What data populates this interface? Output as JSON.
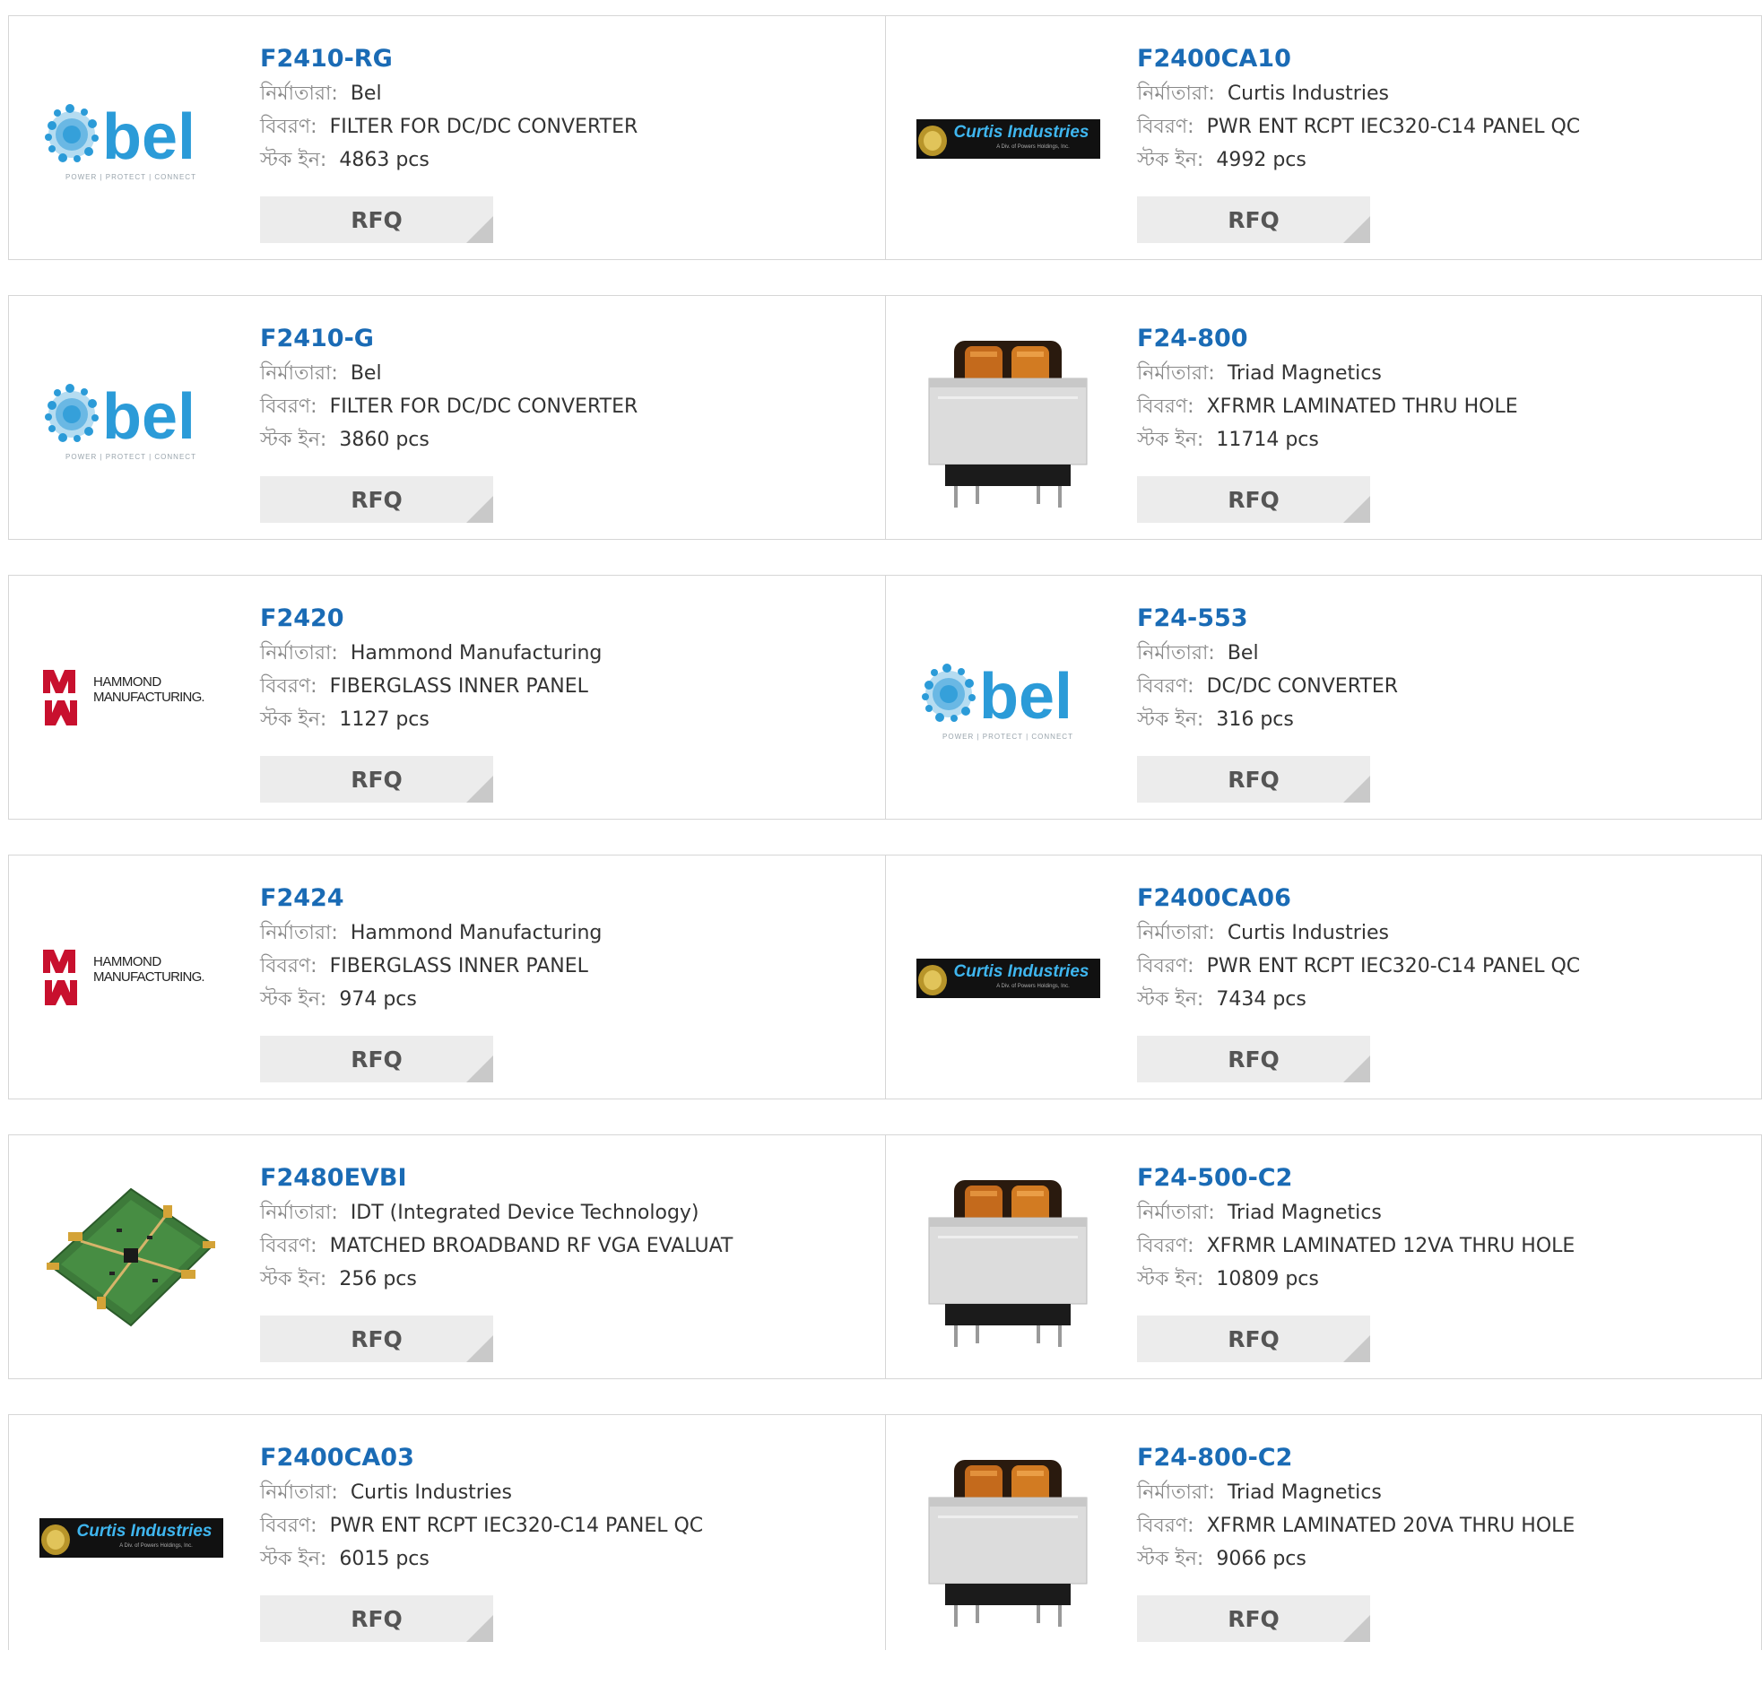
{
  "labels": {
    "manufacturer": "নির্মাতারা:",
    "description": "বিবরণ:",
    "stock": "স্টক ইন:",
    "rfq": "RFQ"
  },
  "colors": {
    "part_link": "#1a6bb5",
    "bel_blue": "#2b9bd8",
    "hammond_red": "#c8102e",
    "curtis_bg": "#111111",
    "curtis_text": "#3fb6ef"
  },
  "products": [
    {
      "part": "F2410-RG",
      "manufacturer": "Bel",
      "description": "FILTER FOR DC/DC CONVERTER",
      "stock": "4863 pcs",
      "image": "bel-logo"
    },
    {
      "part": "F2400CA10",
      "manufacturer": "Curtis Industries",
      "description": "PWR ENT RCPT IEC320-C14 PANEL QC",
      "stock": "4992 pcs",
      "image": "curtis-logo"
    },
    {
      "part": "F2410-G",
      "manufacturer": "Bel",
      "description": "FILTER FOR DC/DC CONVERTER",
      "stock": "3860 pcs",
      "image": "bel-logo"
    },
    {
      "part": "F24-800",
      "manufacturer": "Triad Magnetics",
      "description": "XFRMR LAMINATED THRU HOLE",
      "stock": "11714 pcs",
      "image": "transformer-photo"
    },
    {
      "part": "F2420",
      "manufacturer": "Hammond Manufacturing",
      "description": "FIBERGLASS INNER PANEL",
      "stock": "1127 pcs",
      "image": "hammond-logo"
    },
    {
      "part": "F24-553",
      "manufacturer": "Bel",
      "description": "DC/DC CONVERTER",
      "stock": "316 pcs",
      "image": "bel-logo"
    },
    {
      "part": "F2424",
      "manufacturer": "Hammond Manufacturing",
      "description": "FIBERGLASS INNER PANEL",
      "stock": "974 pcs",
      "image": "hammond-logo"
    },
    {
      "part": "F2400CA06",
      "manufacturer": "Curtis Industries",
      "description": "PWR ENT RCPT IEC320-C14 PANEL QC",
      "stock": "7434 pcs",
      "image": "curtis-logo"
    },
    {
      "part": "F2480EVBI",
      "manufacturer": "IDT (Integrated Device Technology)",
      "description": "MATCHED BROADBAND RF VGA EVALUAT",
      "stock": "256 pcs",
      "image": "pcb-board-photo"
    },
    {
      "part": "F24-500-C2",
      "manufacturer": "Triad Magnetics",
      "description": "XFRMR LAMINATED 12VA THRU HOLE",
      "stock": "10809 pcs",
      "image": "transformer-photo"
    },
    {
      "part": "F2400CA03",
      "manufacturer": "Curtis Industries",
      "description": "PWR ENT RCPT IEC320-C14 PANEL QC",
      "stock": "6015 pcs",
      "image": "curtis-logo"
    },
    {
      "part": "F24-800-C2",
      "manufacturer": "Triad Magnetics",
      "description": "XFRMR LAMINATED 20VA THRU HOLE",
      "stock": "9066 pcs",
      "image": "transformer-photo"
    }
  ],
  "logo_text": {
    "bel": "bel",
    "bel_tagline": "POWER | PROTECT | CONNECT",
    "hammond_line1": "HAMMOND",
    "hammond_line2": "MANUFACTURING.",
    "curtis": "Curtis Industries",
    "curtis_sub": "A Div. of Powers Holdings, Inc."
  }
}
